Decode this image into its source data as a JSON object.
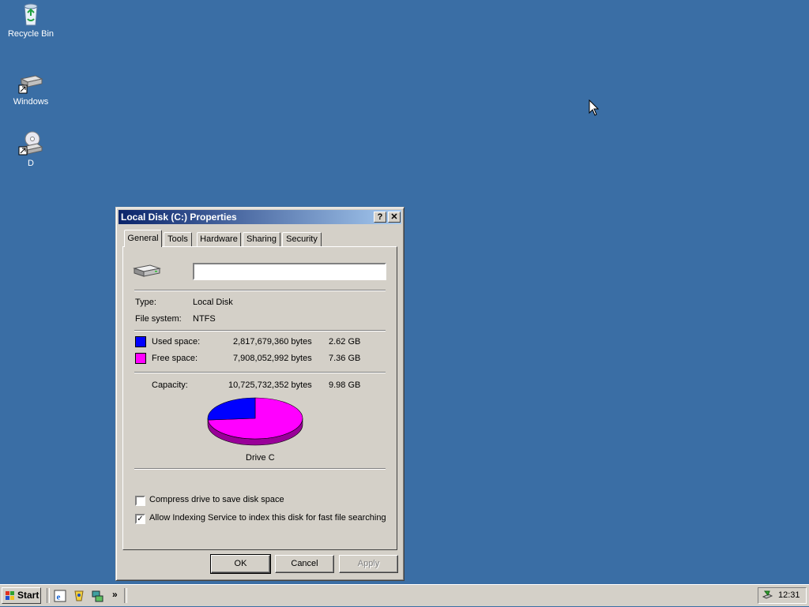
{
  "desktop": {
    "icons": [
      {
        "label": "Recycle Bin",
        "icon": "recycle-bin-icon"
      },
      {
        "label": "Windows",
        "icon": "drive-shortcut-icon"
      },
      {
        "label": "D",
        "icon": "cd-drive-shortcut-icon"
      }
    ]
  },
  "dialog": {
    "title": "Local Disk (C:) Properties",
    "help_label": "?",
    "close_label": "✕",
    "tabs": [
      {
        "label": "General",
        "active": true
      },
      {
        "label": "Tools"
      },
      {
        "label": "Hardware"
      },
      {
        "label": "Sharing"
      },
      {
        "label": "Security"
      }
    ],
    "general": {
      "name_value": "",
      "type_label": "Type:",
      "type_value": "Local Disk",
      "fs_label": "File system:",
      "fs_value": "NTFS",
      "used_label": "Used space:",
      "used_bytes": "2,817,679,360 bytes",
      "used_gb": "2.62 GB",
      "free_label": "Free space:",
      "free_bytes": "7,908,052,992 bytes",
      "free_gb": "7.36 GB",
      "capacity_label": "Capacity:",
      "capacity_bytes": "10,725,732,352 bytes",
      "capacity_gb": "9.98 GB",
      "drive_label": "Drive C",
      "used_fraction": 0.263,
      "used_color": "#0000ff",
      "free_color": "#ff00ff",
      "compress_label": "Compress drive to save disk space",
      "compress_checked": false,
      "index_label": "Allow Indexing Service to index this disk for fast file searching",
      "index_checked": true
    },
    "buttons": {
      "ok": "OK",
      "cancel": "Cancel",
      "apply": "Apply"
    }
  },
  "taskbar": {
    "start_label": "Start",
    "quicklaunch_more": "»",
    "clock": "12:31"
  }
}
